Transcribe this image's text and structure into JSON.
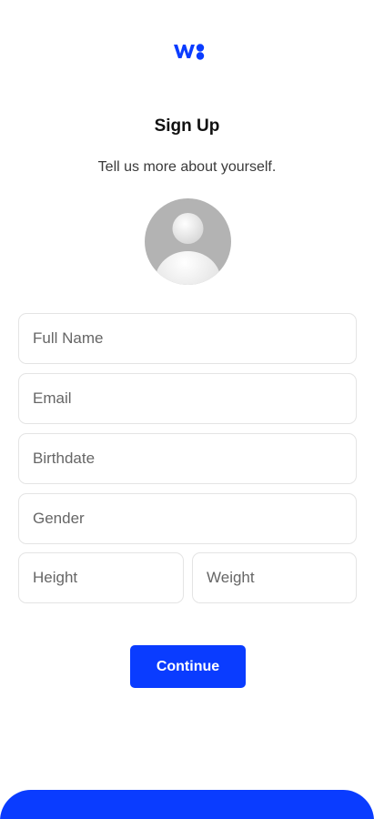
{
  "header": {
    "logo": "brand-logo-icon"
  },
  "page": {
    "title": "Sign Up",
    "subtitle": "Tell us more about yourself."
  },
  "form": {
    "full_name_placeholder": "Full Name",
    "email_placeholder": "Email",
    "birthdate_placeholder": "Birthdate",
    "gender_placeholder": "Gender",
    "height_placeholder": "Height",
    "weight_placeholder": "Weight"
  },
  "actions": {
    "continue_label": "Continue"
  },
  "colors": {
    "accent": "#0a3cff",
    "avatar_bg": "#b3b3b3",
    "field_border": "#e4e4e4"
  }
}
